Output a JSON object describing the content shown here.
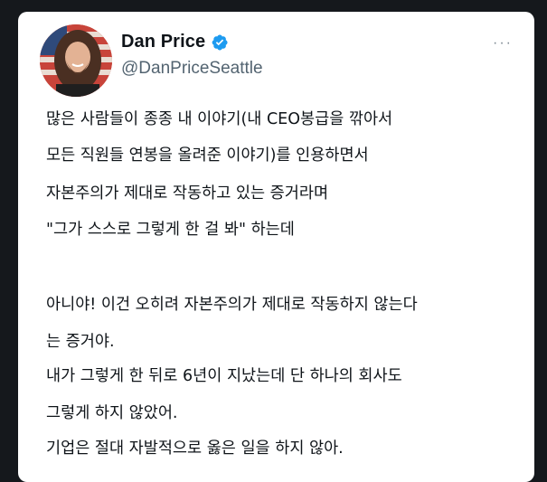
{
  "tweet": {
    "author": {
      "display_name": "Dan Price",
      "handle": "@DanPriceSeattle",
      "verified_icon": "verified-badge-icon",
      "avatar_icon": "avatar"
    },
    "more_icon": "more-options-icon",
    "more_label": "···",
    "paragraph1": [
      "많은 사람들이 종종 내 이야기(내 CEO봉급을 깎아서",
      "모든 직원들 연봉을 올려준 이야기)를 인용하면서",
      "자본주의가 제대로 작동하고 있는 증거라며",
      "\"그가 스스로 그렇게 한 걸 봐\" 하는데"
    ],
    "paragraph2": [
      "아니야! 이건 오히려 자본주의가 제대로 작동하지 않는다",
      "는 증거야.",
      "내가 그렇게 한 뒤로 6년이 지났는데 단 하나의 회사도",
      "그렇게 하지 않았어.",
      "기업은 절대 자발적으로 옳은 일을 하지 않아."
    ],
    "colors": {
      "verified": "#1d9bf0",
      "text": "#0f1419",
      "secondary": "#536471",
      "background": "#15181c"
    }
  }
}
